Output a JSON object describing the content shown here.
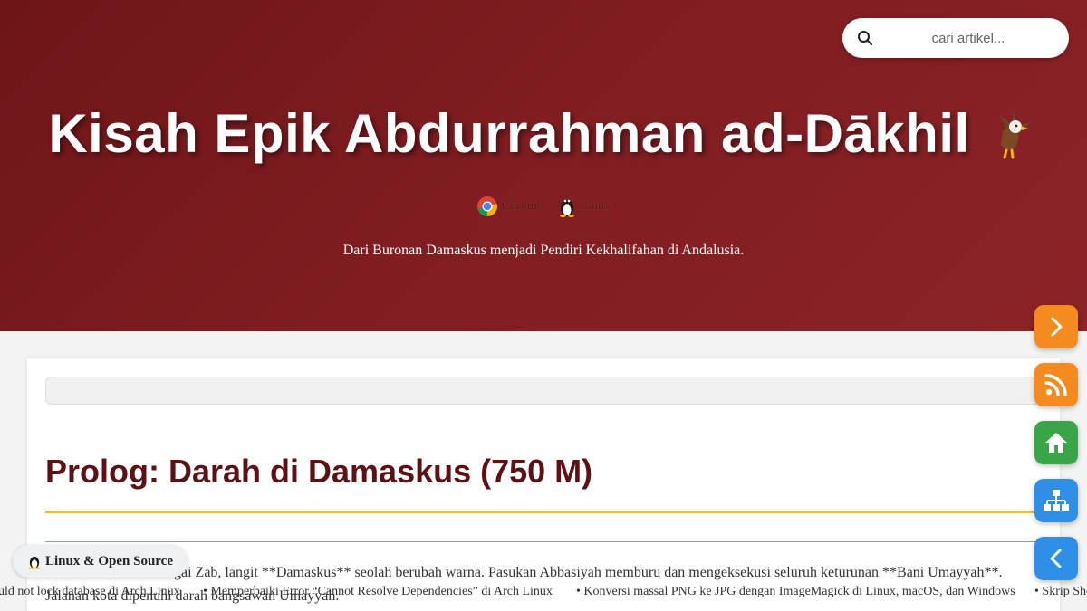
{
  "header": {
    "search_placeholder": "cari artikel...",
    "title": "Kisah Epik Abdurrahman ad-Dākhil",
    "title_icon": "eagle-icon",
    "platforms": [
      {
        "label": "Chrome",
        "icon": "chrome-icon"
      },
      {
        "label": "Linux",
        "icon": "tux-icon"
      }
    ],
    "subtitle": "Dari Buronan Damaskus menjadi Pendiri Kekhalifahan di Andalusia."
  },
  "article": {
    "heading": "Prolog: Darah di Damaskus (750 M)",
    "paragraph_line1": "ungai Zab, langit **Damaskus** seolah berubah warna. Pasukan Abbasiyah memburu dan mengeksekusi seluruh keturunan **Bani Umayyah**.",
    "paragraph_line2": "Jalanan kota dipenuhi darah bangsawan Umayyah."
  },
  "badge": {
    "label": "Linux & Open Source",
    "icon": "tux-icon"
  },
  "ticker": {
    "items": [
      "uld not lock database di Arch Linux",
      "Memperbaiki Error “Cannot Resolve Dependencies” di Arch Linux",
      "Konversi massal PNG ke JPG dengan ImageMagick di Linux, macOS, dan Windows",
      "Skrip She"
    ]
  },
  "side_buttons": [
    {
      "name": "next",
      "icon": "chevron-right-icon",
      "color": "#f58a1f"
    },
    {
      "name": "rss",
      "icon": "rss-icon",
      "color": "#f58a1f"
    },
    {
      "name": "home",
      "icon": "home-icon",
      "color": "#3aa547"
    },
    {
      "name": "sitemap",
      "icon": "sitemap-icon",
      "color": "#2f8fe6"
    },
    {
      "name": "prev",
      "icon": "chevron-left-icon",
      "color": "#2f8fe6"
    }
  ],
  "colors": {
    "header_bg": "#7f1d21",
    "heading": "#5c1114",
    "accent_line": "#f0c419"
  }
}
